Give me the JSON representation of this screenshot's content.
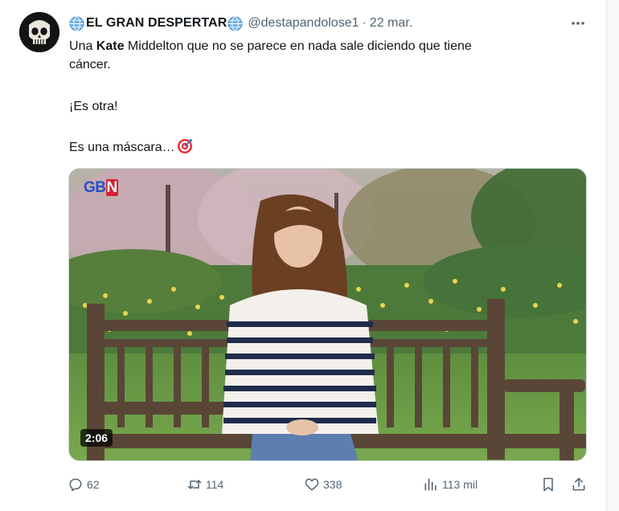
{
  "tweet": {
    "author_name": "EL GRAN DESPERTAR",
    "handle": "@destapandolose1",
    "separator": "·",
    "date": "22 mar.",
    "lines": {
      "line1_prefix": "Una ",
      "line1_bold": "Kate",
      "line1_suffix": " Middelton que no se parece en nada sale diciendo que tiene",
      "line2": "cáncer.",
      "line3": "¡Es otra!",
      "line4": "Es una máscara…"
    }
  },
  "media": {
    "channel_logo": "GBN",
    "duration": "2:06"
  },
  "actions": {
    "replies": "62",
    "reposts": "114",
    "likes": "338",
    "views": "113 mil"
  },
  "icons": {
    "avatar": "skull-avatar",
    "globe": "globe-icon",
    "more": "more-icon",
    "target": "target-emoji",
    "reply": "reply-icon",
    "repost": "repost-icon",
    "like": "heart-icon",
    "views": "views-icon",
    "bookmark": "bookmark-icon",
    "share": "share-icon"
  },
  "colors": {
    "text": "#0f1419",
    "secondary": "#536471",
    "gbn_blue": "#2450c7",
    "gbn_red": "#d32033"
  }
}
